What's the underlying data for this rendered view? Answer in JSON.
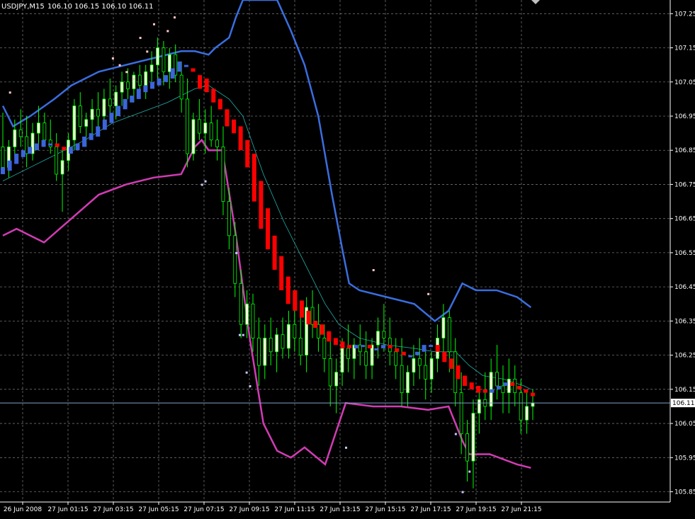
{
  "header": {
    "symbol_tf": "USDJPY,M15",
    "ohlc": "106.10 106.15 106.10 106.11"
  },
  "colors": {
    "background": "#000000",
    "grid": "#a0a0a0",
    "axis_text": "#ffffff",
    "bull_candle": "#00ff00",
    "bull_body": "#ffffe0",
    "bear_candle": "#00ff00",
    "haiken_bull": "#3c64dc",
    "haiken_bear": "#ff0000",
    "upper_band": "#3a6ee0",
    "lower_band": "#d23cb4",
    "ma_line": "#20b2aa",
    "dots_up": "#ffc8c8",
    "dots_down": "#c8c8ff",
    "price_line": "#7fa2c8"
  },
  "chart_data": {
    "type": "candlestick",
    "y_axis": {
      "ticks": [
        "107.25",
        "107.15",
        "107.05",
        "106.95",
        "106.85",
        "106.75",
        "106.65",
        "106.55",
        "106.45",
        "106.35",
        "106.25",
        "106.15",
        "106.05",
        "105.95",
        "105.85"
      ],
      "range": [
        105.82,
        107.29
      ],
      "current_price": "106.11"
    },
    "x_axis": {
      "ticks": [
        "26 Jun 2008",
        "27 Jun 01:15",
        "27 Jun 03:15",
        "27 Jun 05:15",
        "27 Jun 07:15",
        "27 Jun 09:15",
        "27 Jun 11:15",
        "27 Jun 13:15",
        "27 Jun 15:15",
        "27 Jun 17:15",
        "27 Jun 19:15",
        "27 Jun 21:15"
      ]
    },
    "candles": [
      [
        106.86,
        106.96,
        106.78,
        106.8
      ],
      [
        106.8,
        106.88,
        106.77,
        106.86
      ],
      [
        106.86,
        106.94,
        106.83,
        106.91
      ],
      [
        106.91,
        106.97,
        106.86,
        106.89
      ],
      [
        106.89,
        106.95,
        106.8,
        106.84
      ],
      [
        106.84,
        106.93,
        106.82,
        106.9
      ],
      [
        106.9,
        106.98,
        106.85,
        106.93
      ],
      [
        106.93,
        106.96,
        106.86,
        106.88
      ],
      [
        106.88,
        106.94,
        106.84,
        106.86
      ],
      [
        106.86,
        106.9,
        106.76,
        106.78
      ],
      [
        106.78,
        106.86,
        106.67,
        106.82
      ],
      [
        106.82,
        106.9,
        106.79,
        106.88
      ],
      [
        106.88,
        107.0,
        106.85,
        106.98
      ],
      [
        106.98,
        107.02,
        106.9,
        106.92
      ],
      [
        106.92,
        106.96,
        106.86,
        106.94
      ],
      [
        106.94,
        107.0,
        106.9,
        106.97
      ],
      [
        106.97,
        107.02,
        106.92,
        106.95
      ],
      [
        106.95,
        107.03,
        106.91,
        107.0
      ],
      [
        107.0,
        107.06,
        106.96,
        106.98
      ],
      [
        106.98,
        107.04,
        106.94,
        107.02
      ],
      [
        107.02,
        107.08,
        106.98,
        107.05
      ],
      [
        107.05,
        107.09,
        107.0,
        107.03
      ],
      [
        107.03,
        107.08,
        106.99,
        107.07
      ],
      [
        107.07,
        107.1,
        107.02,
        107.04
      ],
      [
        107.04,
        107.1,
        107.0,
        107.08
      ],
      [
        107.08,
        107.14,
        107.04,
        107.1
      ],
      [
        107.1,
        107.18,
        107.06,
        107.15
      ],
      [
        107.15,
        107.17,
        107.04,
        107.08
      ],
      [
        107.08,
        107.15,
        107.03,
        107.13
      ],
      [
        107.13,
        107.16,
        107.05,
        107.07
      ],
      [
        107.07,
        107.11,
        106.96,
        107.0
      ],
      [
        107.0,
        107.06,
        106.8,
        106.84
      ],
      [
        106.84,
        106.96,
        106.82,
        106.94
      ],
      [
        106.94,
        107.0,
        106.88,
        106.9
      ],
      [
        106.9,
        106.97,
        106.84,
        106.93
      ],
      [
        106.93,
        106.98,
        106.86,
        106.88
      ],
      [
        106.88,
        106.94,
        106.82,
        106.86
      ],
      [
        106.86,
        106.92,
        106.66,
        106.7
      ],
      [
        106.7,
        106.74,
        106.56,
        106.6
      ],
      [
        106.6,
        106.64,
        106.42,
        106.46
      ],
      [
        106.46,
        106.5,
        106.3,
        106.34
      ],
      [
        106.34,
        106.44,
        106.3,
        106.4
      ],
      [
        106.4,
        106.43,
        106.26,
        106.3
      ],
      [
        106.3,
        106.36,
        106.16,
        106.22
      ],
      [
        106.22,
        106.34,
        106.18,
        106.3
      ],
      [
        106.3,
        106.36,
        106.22,
        106.26
      ],
      [
        106.26,
        106.33,
        106.2,
        106.31
      ],
      [
        106.31,
        106.36,
        106.24,
        106.27
      ],
      [
        106.27,
        106.38,
        106.24,
        106.34
      ],
      [
        106.34,
        106.4,
        106.26,
        106.3
      ],
      [
        106.3,
        106.36,
        106.22,
        106.25
      ],
      [
        106.25,
        106.42,
        106.2,
        106.39
      ],
      [
        106.39,
        106.44,
        106.3,
        106.34
      ],
      [
        106.34,
        106.4,
        106.26,
        106.3
      ],
      [
        106.3,
        106.34,
        106.2,
        106.24
      ],
      [
        106.24,
        106.3,
        106.1,
        106.16
      ],
      [
        106.16,
        106.24,
        106.08,
        106.2
      ],
      [
        106.2,
        106.3,
        106.16,
        106.27
      ],
      [
        106.27,
        106.34,
        106.2,
        106.24
      ],
      [
        106.24,
        106.3,
        106.18,
        106.28
      ],
      [
        106.28,
        106.34,
        106.22,
        106.26
      ],
      [
        106.26,
        106.32,
        106.18,
        106.22
      ],
      [
        106.22,
        106.3,
        106.18,
        106.28
      ],
      [
        106.28,
        106.36,
        106.24,
        106.32
      ],
      [
        106.32,
        106.4,
        106.26,
        106.3
      ],
      [
        106.3,
        106.36,
        106.22,
        106.26
      ],
      [
        106.26,
        106.3,
        106.18,
        106.22
      ],
      [
        106.22,
        106.3,
        106.1,
        106.14
      ],
      [
        106.14,
        106.22,
        106.1,
        106.2
      ],
      [
        106.2,
        106.28,
        106.16,
        106.24
      ],
      [
        106.24,
        106.3,
        106.18,
        106.22
      ],
      [
        106.22,
        106.28,
        106.12,
        106.18
      ],
      [
        106.18,
        106.26,
        106.14,
        106.24
      ],
      [
        106.24,
        106.34,
        106.2,
        106.3
      ],
      [
        106.3,
        106.4,
        106.26,
        106.36
      ],
      [
        106.36,
        106.38,
        106.2,
        106.26
      ],
      [
        106.26,
        106.3,
        106.1,
        106.14
      ],
      [
        106.14,
        106.2,
        105.96,
        106.02
      ],
      [
        106.02,
        106.06,
        105.88,
        105.94
      ],
      [
        105.94,
        106.12,
        105.86,
        106.08
      ],
      [
        106.08,
        106.16,
        106.02,
        106.12
      ],
      [
        106.12,
        106.2,
        106.06,
        106.1
      ],
      [
        106.1,
        106.24,
        106.06,
        106.2
      ],
      [
        106.2,
        106.28,
        106.12,
        106.16
      ],
      [
        106.16,
        106.22,
        106.08,
        106.14
      ],
      [
        106.14,
        106.24,
        106.08,
        106.18
      ],
      [
        106.18,
        106.22,
        106.1,
        106.14
      ],
      [
        106.14,
        106.18,
        106.02,
        106.06
      ],
      [
        106.06,
        106.14,
        106.02,
        106.1
      ],
      [
        106.1,
        106.15,
        106.06,
        106.11
      ]
    ],
    "haiken_ashi": [
      [
        106.78,
        106.8
      ],
      [
        106.79,
        106.82
      ],
      [
        106.81,
        106.84
      ],
      [
        106.83,
        106.85
      ],
      [
        106.84,
        106.86
      ],
      [
        106.85,
        106.87
      ],
      [
        106.86,
        106.88
      ],
      [
        106.87,
        106.87
      ],
      [
        106.87,
        106.86
      ],
      [
        106.86,
        106.85
      ],
      [
        106.84,
        106.86
      ],
      [
        106.85,
        106.87
      ],
      [
        106.86,
        106.89
      ],
      [
        106.88,
        106.9
      ],
      [
        106.89,
        106.92
      ],
      [
        106.91,
        106.94
      ],
      [
        106.93,
        106.96
      ],
      [
        106.95,
        106.98
      ],
      [
        106.97,
        107.0
      ],
      [
        106.99,
        107.01
      ],
      [
        107.0,
        107.03
      ],
      [
        107.02,
        107.04
      ],
      [
        107.03,
        107.05
      ],
      [
        107.04,
        107.06
      ],
      [
        107.05,
        107.07
      ],
      [
        107.06,
        107.09
      ],
      [
        107.08,
        107.11
      ],
      [
        107.1,
        107.1
      ],
      [
        107.09,
        107.08
      ],
      [
        107.07,
        107.03
      ],
      [
        107.06,
        107.02
      ],
      [
        107.03,
        106.99
      ],
      [
        107.0,
        106.97
      ],
      [
        106.97,
        106.92
      ],
      [
        106.94,
        106.9
      ],
      [
        106.92,
        106.85
      ],
      [
        106.88,
        106.8
      ],
      [
        106.84,
        106.7
      ],
      [
        106.76,
        106.62
      ],
      [
        106.68,
        106.56
      ],
      [
        106.6,
        106.5
      ],
      [
        106.54,
        106.44
      ],
      [
        106.48,
        106.4
      ],
      [
        106.44,
        106.38
      ],
      [
        106.41,
        106.36
      ],
      [
        106.38,
        106.34
      ],
      [
        106.35,
        106.33
      ],
      [
        106.34,
        106.31
      ],
      [
        106.32,
        106.29
      ],
      [
        106.3,
        106.28
      ],
      [
        106.29,
        106.27
      ],
      [
        106.28,
        106.27
      ],
      [
        106.27,
        106.28
      ],
      [
        106.28,
        106.28
      ],
      [
        106.28,
        106.27
      ],
      [
        106.27,
        106.27
      ],
      [
        106.27,
        106.28
      ],
      [
        106.28,
        106.27
      ],
      [
        106.27,
        106.26
      ],
      [
        106.26,
        106.25
      ],
      [
        106.25,
        106.25
      ],
      [
        106.25,
        106.26
      ],
      [
        106.26,
        106.28
      ],
      [
        106.28,
        106.28
      ],
      [
        106.28,
        106.26
      ],
      [
        106.26,
        106.23
      ],
      [
        106.24,
        106.21
      ],
      [
        106.22,
        106.18
      ],
      [
        106.19,
        106.16
      ],
      [
        106.17,
        106.15
      ],
      [
        106.16,
        106.14
      ],
      [
        106.15,
        106.14
      ],
      [
        106.14,
        106.15
      ],
      [
        106.15,
        106.16
      ],
      [
        106.16,
        106.17
      ],
      [
        106.17,
        106.16
      ],
      [
        106.16,
        106.15
      ],
      [
        106.15,
        106.14
      ],
      [
        106.14,
        106.13
      ]
    ],
    "upper_band": [
      [
        0,
        106.98
      ],
      [
        3,
        106.92
      ],
      [
        8,
        106.95
      ],
      [
        15,
        107.0
      ],
      [
        20,
        107.04
      ],
      [
        28,
        107.08
      ],
      [
        36,
        107.1
      ],
      [
        44,
        107.12
      ],
      [
        52,
        107.14
      ],
      [
        56,
        107.14
      ],
      [
        60,
        107.13
      ],
      [
        62,
        107.15
      ],
      [
        66,
        107.18
      ],
      [
        68,
        107.24
      ],
      [
        70,
        107.29
      ],
      [
        80,
        107.29
      ],
      [
        84,
        107.2
      ],
      [
        88,
        107.1
      ],
      [
        92,
        106.95
      ],
      [
        96,
        106.72
      ],
      [
        99,
        106.56
      ],
      [
        101,
        106.46
      ],
      [
        104,
        106.44
      ],
      [
        112,
        106.42
      ],
      [
        120,
        106.4
      ],
      [
        126,
        106.35
      ],
      [
        130,
        106.38
      ],
      [
        134,
        106.46
      ],
      [
        138,
        106.44
      ],
      [
        144,
        106.44
      ],
      [
        150,
        106.42
      ],
      [
        154,
        106.39
      ]
    ],
    "lower_band": [
      [
        0,
        106.6
      ],
      [
        4,
        106.62
      ],
      [
        12,
        106.58
      ],
      [
        20,
        106.65
      ],
      [
        28,
        106.72
      ],
      [
        36,
        106.75
      ],
      [
        44,
        106.77
      ],
      [
        52,
        106.78
      ],
      [
        54,
        106.82
      ],
      [
        56,
        106.86
      ],
      [
        58,
        106.88
      ],
      [
        60,
        106.85
      ],
      [
        64,
        106.85
      ],
      [
        68,
        106.6
      ],
      [
        72,
        106.3
      ],
      [
        76,
        106.05
      ],
      [
        80,
        105.97
      ],
      [
        84,
        105.95
      ],
      [
        88,
        105.98
      ],
      [
        94,
        105.93
      ],
      [
        100,
        106.11
      ],
      [
        108,
        106.1
      ],
      [
        116,
        106.1
      ],
      [
        124,
        106.09
      ],
      [
        130,
        106.1
      ],
      [
        134,
        106.0
      ],
      [
        136,
        105.96
      ],
      [
        142,
        105.96
      ],
      [
        150,
        105.93
      ],
      [
        154,
        105.92
      ]
    ],
    "ma_line": [
      [
        0,
        106.76
      ],
      [
        8,
        106.8
      ],
      [
        16,
        106.84
      ],
      [
        24,
        106.88
      ],
      [
        32,
        106.93
      ],
      [
        40,
        106.96
      ],
      [
        48,
        106.99
      ],
      [
        56,
        107.03
      ],
      [
        60,
        107.04
      ],
      [
        66,
        107.0
      ],
      [
        70,
        106.95
      ],
      [
        76,
        106.78
      ],
      [
        82,
        106.64
      ],
      [
        88,
        106.52
      ],
      [
        94,
        106.4
      ],
      [
        98,
        106.34
      ],
      [
        104,
        106.3
      ],
      [
        112,
        106.28
      ],
      [
        120,
        106.27
      ],
      [
        126,
        106.26
      ],
      [
        132,
        106.26
      ],
      [
        136,
        106.22
      ],
      [
        140,
        106.19
      ],
      [
        146,
        106.18
      ],
      [
        152,
        106.16
      ],
      [
        154,
        106.15
      ]
    ],
    "dots_up": [
      [
        32,
        107.12
      ],
      [
        34,
        107.1
      ],
      [
        36,
        107.08
      ],
      [
        38,
        107.06
      ],
      [
        2,
        107.02
      ],
      [
        40,
        107.18
      ],
      [
        42,
        107.14
      ],
      [
        44,
        107.22
      ],
      [
        48,
        107.2
      ],
      [
        50,
        107.24
      ],
      [
        108,
        106.5
      ],
      [
        124,
        106.43
      ]
    ],
    "dots_down": [
      [
        58,
        106.75
      ],
      [
        59,
        106.76
      ],
      [
        68,
        106.55
      ],
      [
        69,
        106.31
      ],
      [
        70,
        106.31
      ],
      [
        71,
        106.2
      ],
      [
        72,
        106.16
      ],
      [
        100,
        105.98
      ],
      [
        132,
        106.02
      ],
      [
        134,
        105.85
      ],
      [
        136,
        105.91
      ]
    ]
  }
}
